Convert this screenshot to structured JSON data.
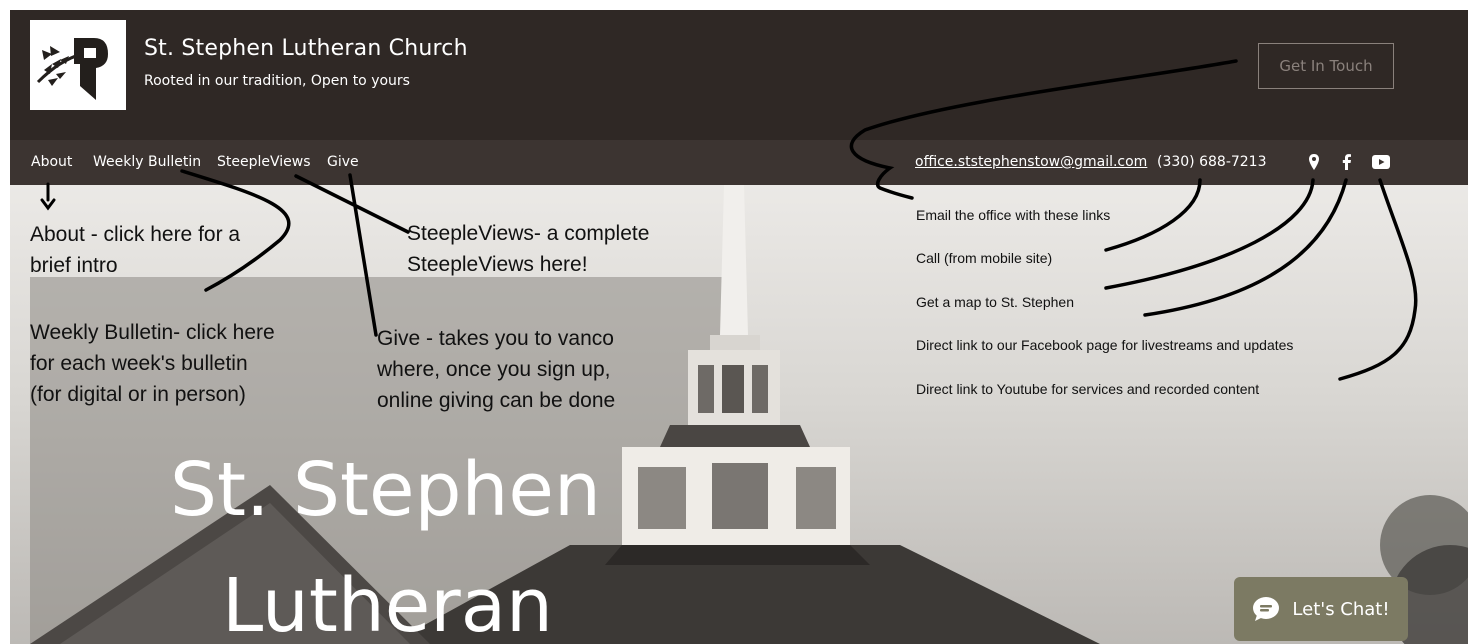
{
  "header": {
    "site_title": "St. Stephen Lutheran Church",
    "tagline": "Rooted in our tradition, Open to yours",
    "cta_label": "Get In Touch"
  },
  "nav": {
    "items": [
      "About",
      "Weekly Bulletin",
      "SteepleViews",
      "Give"
    ],
    "email": "office.ststephenstow@gmail.com",
    "phone": "(330) 688-7213",
    "social_icons": [
      "map-pin-icon",
      "facebook-icon",
      "youtube-icon"
    ]
  },
  "hero": {
    "title_line1": "St. Stephen",
    "title_line2": "Lutheran"
  },
  "annotations": {
    "about_line1": "About - click here for a",
    "about_line2": "brief intro",
    "bulletin_line1": "Weekly Bulletin- click here",
    "bulletin_line2": "for each week's bulletin",
    "bulletin_line3": "(for digital or in person)",
    "steeple_line1": "SteepleViews- a complete",
    "steeple_line2": "SteepleViews here!",
    "give_line1": "Give - takes you to vanco",
    "give_line2": "where, once you sign up,",
    "give_line3": "online giving can be done",
    "email_note": "Email the office with these links",
    "call_note": "Call (from mobile site)",
    "map_note": "Get a map to St. Stephen",
    "facebook_note": "Direct link to our Facebook page for livestreams and updates",
    "youtube_note": "Direct link to Youtube for services and recorded content"
  },
  "chat": {
    "label": "Let's Chat!"
  },
  "colors": {
    "header_bg": "#2f2825",
    "nav_bg": "#3c3431",
    "chat_bg": "#7c7a63",
    "cta_border": "#8a817c"
  }
}
